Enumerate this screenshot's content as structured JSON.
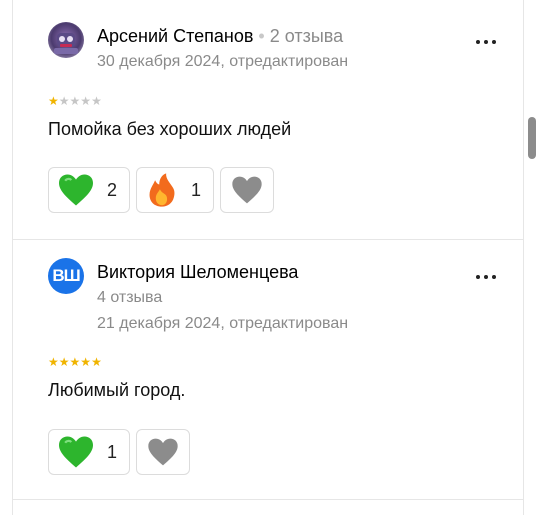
{
  "reviews": [
    {
      "author": "Арсений Степанов",
      "review_count": "2 отзыва",
      "date": "30 декабря 2024, отредактирован",
      "rating": 1,
      "text": "Помойка без хороших людей",
      "reactions": [
        {
          "icon": "green-heart",
          "count": "2"
        },
        {
          "icon": "fire",
          "count": "1"
        },
        {
          "icon": "grey-heart",
          "count": ""
        }
      ]
    },
    {
      "author": "Виктория Шеломенцева",
      "avatar_initials": "ВШ",
      "review_count": "4 отзыва",
      "date": "21 декабря 2024, отредактирован",
      "rating": 5,
      "text": "Любимый город.",
      "reactions": [
        {
          "icon": "green-heart",
          "count": "1"
        },
        {
          "icon": "grey-heart",
          "count": ""
        }
      ]
    }
  ],
  "colors": {
    "star_on": "#f0b400",
    "star_off": "#c6c6c6",
    "green_heart": "#2db52d",
    "grey_heart": "#8c8c8c",
    "avatar_bg": "#1a73e8"
  }
}
